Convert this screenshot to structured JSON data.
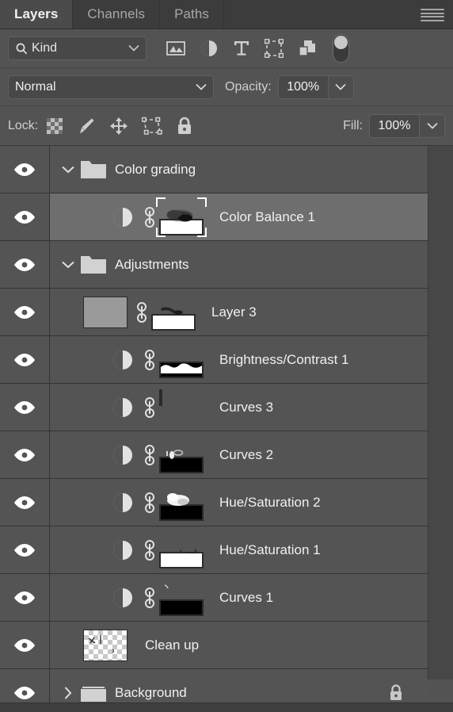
{
  "panel": {
    "tabs": [
      {
        "label": "Layers",
        "active": true
      },
      {
        "label": "Channels",
        "active": false
      },
      {
        "label": "Paths",
        "active": false
      }
    ],
    "menu_icon": "hamburger-menu-icon"
  },
  "filter": {
    "kind_label": "Kind",
    "search_icon": "magnifier-icon",
    "dropdown_icon": "chevron-down-icon",
    "type_icons": [
      "pixel-layer-filter-icon",
      "adjustment-layer-filter-icon",
      "type-layer-filter-icon",
      "shape-layer-filter-icon",
      "smart-object-filter-icon"
    ],
    "toggle_name": "filter-enable-toggle"
  },
  "blend": {
    "mode": "Normal",
    "opacity_label": "Opacity:",
    "opacity_value": "100%",
    "dropdown_icon": "chevron-down-icon"
  },
  "lock": {
    "label": "Lock:",
    "icons": [
      "lock-transparent-pixels-icon",
      "lock-image-pixels-icon",
      "lock-position-icon",
      "prevent-nesting-icon",
      "lock-all-icon"
    ],
    "fill_label": "Fill:",
    "fill_value": "100%"
  },
  "layers": [
    {
      "name": "Color grading",
      "type": "group",
      "visible": true,
      "expanded": true,
      "selected": false,
      "indent": 0,
      "locked": false
    },
    {
      "name": "Color Balance 1",
      "type": "adjustment",
      "visible": true,
      "selected": true,
      "indent": 1,
      "mask": "white",
      "locked": false
    },
    {
      "name": "Adjustments",
      "type": "group",
      "visible": true,
      "expanded": true,
      "selected": false,
      "indent": 0,
      "locked": false
    },
    {
      "name": "Layer 3",
      "type": "pixel",
      "visible": true,
      "selected": false,
      "indent": 1,
      "mask": "white",
      "locked": false
    },
    {
      "name": "Brightness/Contrast 1",
      "type": "adjustment",
      "visible": true,
      "selected": false,
      "indent": 1,
      "mask": "black",
      "locked": false
    },
    {
      "name": "Curves 3",
      "type": "adjustment",
      "visible": true,
      "selected": false,
      "indent": 1,
      "mask": "white",
      "locked": false
    },
    {
      "name": "Curves 2",
      "type": "adjustment",
      "visible": true,
      "selected": false,
      "indent": 1,
      "mask": "black",
      "locked": false
    },
    {
      "name": "Hue/Saturation 2",
      "type": "adjustment",
      "visible": true,
      "selected": false,
      "indent": 1,
      "mask": "black",
      "locked": false
    },
    {
      "name": "Hue/Saturation 1",
      "type": "adjustment",
      "visible": true,
      "selected": false,
      "indent": 1,
      "mask": "white",
      "locked": false
    },
    {
      "name": "Curves 1",
      "type": "adjustment",
      "visible": true,
      "selected": false,
      "indent": 1,
      "mask": "black",
      "locked": false
    },
    {
      "name": "Clean up",
      "type": "transparent",
      "visible": true,
      "selected": false,
      "indent": 1,
      "locked": false
    },
    {
      "name": "Background",
      "type": "group",
      "visible": true,
      "expanded": false,
      "selected": false,
      "indent": 0,
      "locked": true
    }
  ],
  "colors": {
    "panel_bg": "#535353",
    "row_bg": "#545454",
    "row_selected_bg": "#6e6e6e",
    "tab_active_bg": "#4b4b4b",
    "tab_inactive_bg": "#3c3c3c",
    "text": "#f0f0f0",
    "muted_text": "#a8a8a8",
    "field_bg": "#484848",
    "border": "#333333"
  }
}
